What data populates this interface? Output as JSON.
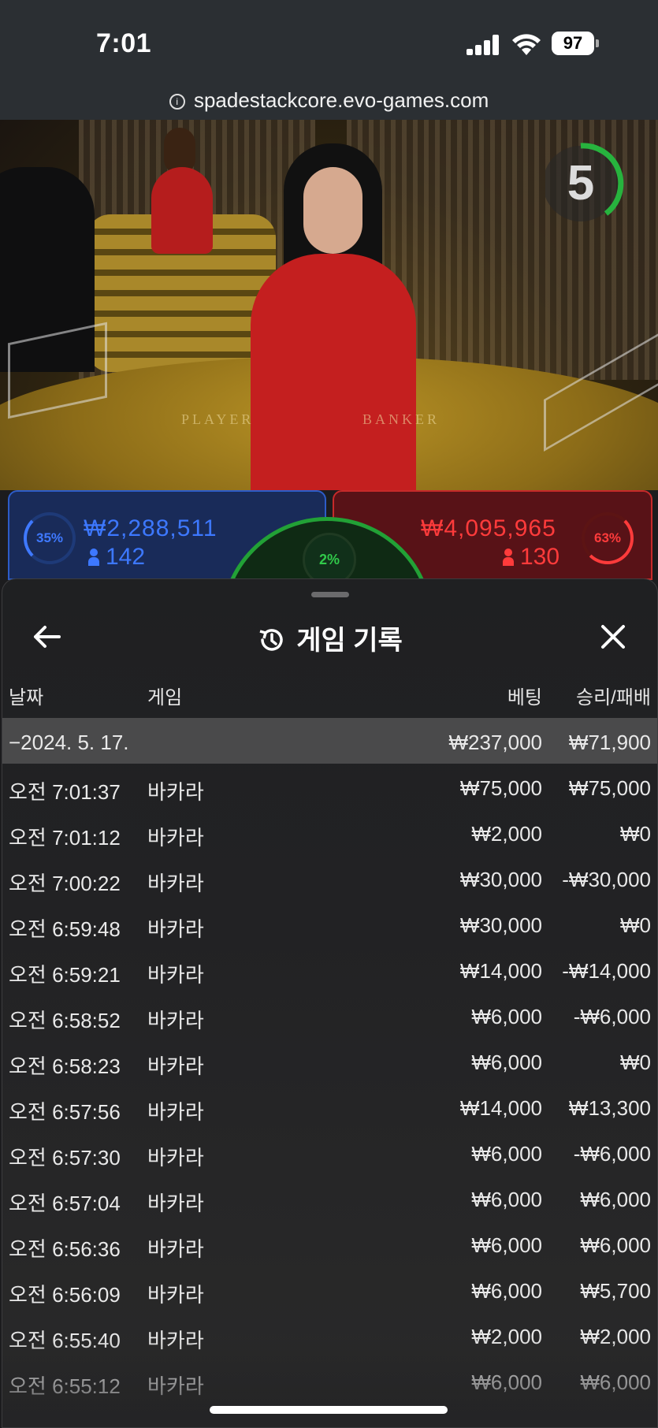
{
  "status_bar": {
    "time": "7:01",
    "battery": "97"
  },
  "browser": {
    "url": "spadestackcore.evo-games.com"
  },
  "video": {
    "table_labels": {
      "player": "PLAYER",
      "banker": "BANKER"
    },
    "countdown": "5"
  },
  "bets": {
    "player": {
      "percent": "35%",
      "amount": "₩2,288,511",
      "count": "142",
      "color": "#2d5cc8"
    },
    "tie": {
      "percent": "2%",
      "color": "#22a136"
    },
    "banker": {
      "percent": "63%",
      "amount": "₩4,095,965",
      "count": "130",
      "color": "#c62a2a"
    }
  },
  "history": {
    "title": "게임 기록",
    "columns": {
      "date": "날짜",
      "game": "게임",
      "bet": "베팅",
      "win_loss": "승리/패배"
    },
    "summary": {
      "date": "−2024. 5. 17.",
      "bet": "₩237,000",
      "win_loss": "₩71,900"
    },
    "rows": [
      {
        "time": "오전 7:01:37",
        "game": "바카라",
        "bet": "₩75,000",
        "win_loss": "₩75,000"
      },
      {
        "time": "오전 7:01:12",
        "game": "바카라",
        "bet": "₩2,000",
        "win_loss": "₩0"
      },
      {
        "time": "오전 7:00:22",
        "game": "바카라",
        "bet": "₩30,000",
        "win_loss": "-₩30,000"
      },
      {
        "time": "오전 6:59:48",
        "game": "바카라",
        "bet": "₩30,000",
        "win_loss": "₩0"
      },
      {
        "time": "오전 6:59:21",
        "game": "바카라",
        "bet": "₩14,000",
        "win_loss": "-₩14,000"
      },
      {
        "time": "오전 6:58:52",
        "game": "바카라",
        "bet": "₩6,000",
        "win_loss": "-₩6,000"
      },
      {
        "time": "오전 6:58:23",
        "game": "바카라",
        "bet": "₩6,000",
        "win_loss": "₩0"
      },
      {
        "time": "오전 6:57:56",
        "game": "바카라",
        "bet": "₩14,000",
        "win_loss": "₩13,300"
      },
      {
        "time": "오전 6:57:30",
        "game": "바카라",
        "bet": "₩6,000",
        "win_loss": "-₩6,000"
      },
      {
        "time": "오전 6:57:04",
        "game": "바카라",
        "bet": "₩6,000",
        "win_loss": "₩6,000"
      },
      {
        "time": "오전 6:56:36",
        "game": "바카라",
        "bet": "₩6,000",
        "win_loss": "₩6,000"
      },
      {
        "time": "오전 6:56:09",
        "game": "바카라",
        "bet": "₩6,000",
        "win_loss": "₩5,700"
      },
      {
        "time": "오전 6:55:40",
        "game": "바카라",
        "bet": "₩2,000",
        "win_loss": "₩2,000"
      },
      {
        "time": "오전 6:55:12",
        "game": "바카라",
        "bet": "₩6,000",
        "win_loss": "₩6,000"
      }
    ]
  },
  "icons": [
    "back-arrow-icon",
    "history-icon",
    "close-icon",
    "info-icon",
    "signal-icon",
    "wifi-icon",
    "battery-icon",
    "person-icon"
  ]
}
